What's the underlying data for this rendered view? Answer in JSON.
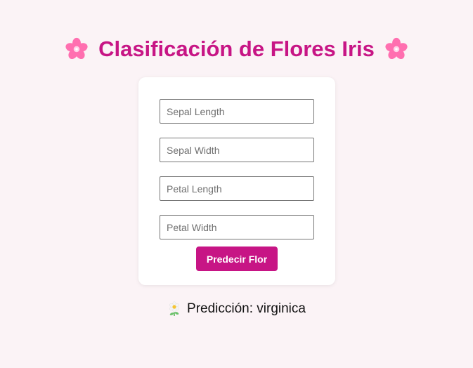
{
  "header": {
    "title": "Clasificación de Flores Iris",
    "left_icon": "cherry-blossom-icon",
    "right_icon": "cherry-blossom-icon"
  },
  "form": {
    "fields": [
      {
        "placeholder": "Sepal Length",
        "value": ""
      },
      {
        "placeholder": "Sepal Width",
        "value": ""
      },
      {
        "placeholder": "Petal Length",
        "value": ""
      },
      {
        "placeholder": "Petal Width",
        "value": ""
      }
    ],
    "submit_label": "Predecir Flor"
  },
  "result": {
    "icon": "daisy-flower-icon",
    "text": "Predicción: virginica"
  },
  "colors": {
    "accent": "#c71585",
    "background": "#fbf3f6",
    "card": "#ffffff",
    "blossom": "#ff6fb0"
  }
}
